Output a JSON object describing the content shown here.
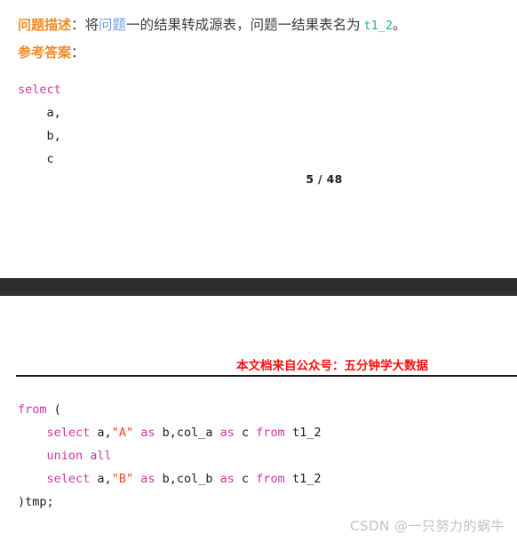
{
  "document": {
    "page_indicator": "5 / 48",
    "header_banner": "本文档来自公众号：五分钟学大数据",
    "watermark": "CSDN @一只努力的蜗牛"
  },
  "colors": {
    "heading_orange": "#f08a28",
    "link_blue": "#6b9ae8",
    "table_teal": "#17b890",
    "sql_keyword": "#d1379d",
    "sql_string": "#e8432b",
    "banner_red": "#fb0e0e",
    "gap_band": "#2b2b2b",
    "watermark_gray": "#c2c2c2",
    "body_text": "#3c3c3c"
  },
  "section_description": {
    "label": "问题描述",
    "label_colon": "：",
    "text_1": "将",
    "highlight_1": "问题",
    "text_2": "一的结果转成源表，问题一结果表名为 ",
    "table_name": "t1_2",
    "text_3": "。"
  },
  "section_answer": {
    "label": "参考答案",
    "label_colon": "："
  },
  "code_upper": {
    "lines": [
      {
        "tokens": [
          {
            "t": "select",
            "c": "kw"
          }
        ]
      },
      {
        "tokens": [
          {
            "t": "    a,",
            "c": "id"
          }
        ]
      },
      {
        "tokens": [
          {
            "t": "    b,",
            "c": "id"
          }
        ]
      },
      {
        "tokens": [
          {
            "t": "    c",
            "c": "id"
          }
        ]
      }
    ]
  },
  "code_lower": {
    "lines": [
      {
        "tokens": [
          {
            "t": "from",
            "c": "kw"
          },
          {
            "t": " (",
            "c": "pl"
          }
        ]
      },
      {
        "tokens": [
          {
            "t": "    ",
            "c": "pl"
          },
          {
            "t": "select",
            "c": "kw"
          },
          {
            "t": " a,",
            "c": "id"
          },
          {
            "t": "\"A\"",
            "c": "str"
          },
          {
            "t": " ",
            "c": "pl"
          },
          {
            "t": "as",
            "c": "kw"
          },
          {
            "t": " b,col_a ",
            "c": "id"
          },
          {
            "t": "as",
            "c": "kw"
          },
          {
            "t": " c ",
            "c": "id"
          },
          {
            "t": "from",
            "c": "kw"
          },
          {
            "t": " t1_2",
            "c": "id"
          }
        ]
      },
      {
        "tokens": [
          {
            "t": "    ",
            "c": "pl"
          },
          {
            "t": "union all",
            "c": "kw"
          }
        ]
      },
      {
        "tokens": [
          {
            "t": "    ",
            "c": "pl"
          },
          {
            "t": "select",
            "c": "kw"
          },
          {
            "t": " a,",
            "c": "id"
          },
          {
            "t": "\"B\"",
            "c": "str"
          },
          {
            "t": " ",
            "c": "pl"
          },
          {
            "t": "as",
            "c": "kw"
          },
          {
            "t": " b,col_b ",
            "c": "id"
          },
          {
            "t": "as",
            "c": "kw"
          },
          {
            "t": " c ",
            "c": "id"
          },
          {
            "t": "from",
            "c": "kw"
          },
          {
            "t": " t1_2",
            "c": "id"
          }
        ]
      },
      {
        "tokens": [
          {
            "t": ")tmp;",
            "c": "id"
          }
        ]
      }
    ]
  }
}
